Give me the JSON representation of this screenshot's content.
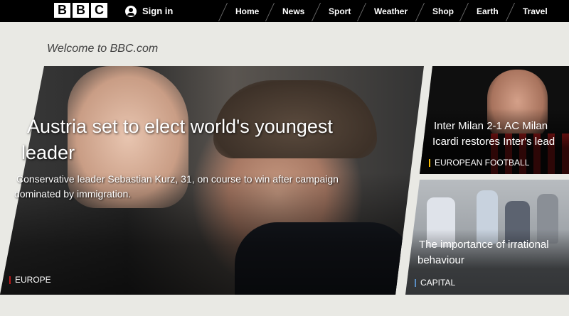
{
  "topbar": {
    "logo_letters": [
      "B",
      "B",
      "C"
    ],
    "signin_label": "Sign in",
    "nav": [
      "Home",
      "News",
      "Sport",
      "Weather",
      "Shop",
      "Earth",
      "Travel"
    ]
  },
  "welcome": "Welcome to BBC.com",
  "hero": {
    "title_line1": "Austria set to elect world's youngest",
    "title_line2": "leader",
    "summary_line1": "Conservative leader Sebastian Kurz, 31, on course to win after campaign",
    "summary_line2": "dominated by immigration.",
    "tag": "EUROPE"
  },
  "side1": {
    "title_line1": "Inter Milan 2-1 AC Milan",
    "title_line2": "Icardi restores Inter's lead",
    "tag": "EUROPEAN FOOTBALL"
  },
  "side2": {
    "title_line1": "The importance of irrational",
    "title_line2": "behaviour",
    "tag": "CAPITAL"
  },
  "colors": {
    "topbar": "#000000",
    "background": "#e9e9e4",
    "tag_red": "#bb1919",
    "tag_yellow": "#f6b900",
    "tag_blue": "#5a8dc3"
  }
}
